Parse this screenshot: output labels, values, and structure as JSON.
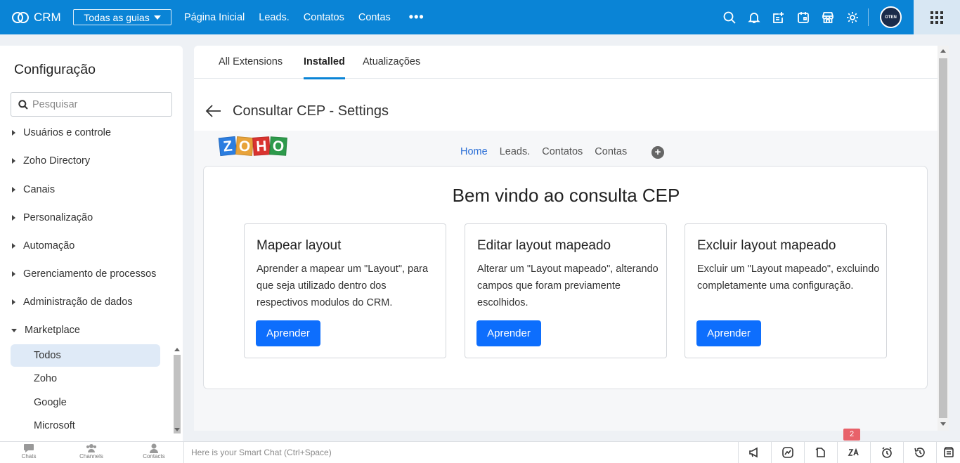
{
  "app": {
    "name": "CRM"
  },
  "topbar": {
    "tab_selector": "Todas as guias",
    "nav": [
      "Página Inicial",
      "Leads.",
      "Contatos",
      "Contas"
    ],
    "more": "•••",
    "avatar_text": "OTEN"
  },
  "sidebar": {
    "title": "Configuração",
    "search_placeholder": "Pesquisar",
    "items": [
      "Usuários e controle",
      "Zoho Directory",
      "Canais",
      "Personalização",
      "Automação",
      "Gerenciamento de processos",
      "Administração de dados",
      "Marketplace"
    ],
    "subitems": [
      "Todos",
      "Zoho",
      "Google",
      "Microsoft"
    ]
  },
  "main": {
    "tabs": [
      "All Extensions",
      "Installed",
      "Atualizações"
    ],
    "page_title": "Consultar CEP - Settings",
    "widget": {
      "logo_letters": [
        "Z",
        "O",
        "H",
        "O"
      ],
      "nav": [
        "Home",
        "Leads.",
        "Contatos",
        "Contas"
      ],
      "heading": "Bem vindo ao consulta CEP",
      "cards": [
        {
          "title": "Mapear layout",
          "text": "Aprender a mapear um \"Layout\", para que seja utilizado dentro dos respectivos modulos do CRM.",
          "button": "Aprender"
        },
        {
          "title": "Editar layout mapeado",
          "text": "Alterar um \"Layout mapeado\", alterando campos que foram previamente escolhidos.",
          "button": "Aprender"
        },
        {
          "title": "Excluir layout mapeado",
          "text": "Excluir um \"Layout mapeado\", excluindo completamente uma configuração.",
          "button": "Aprender"
        }
      ]
    }
  },
  "bottombar": {
    "items": [
      "Chats",
      "Channels",
      "Contacts"
    ],
    "smart_chat_placeholder": "Here is your Smart Chat (Ctrl+Space)",
    "badge": "2"
  },
  "colors": {
    "topbar": "#0a84d6",
    "button": "#0d6efd",
    "link": "#2b6fd6",
    "badge": "#e8626a"
  }
}
